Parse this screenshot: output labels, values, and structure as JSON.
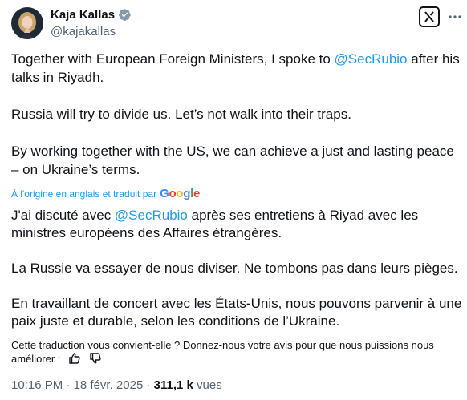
{
  "author": {
    "name": "Kaja Kallas",
    "handle": "@kajakallas"
  },
  "icons": {
    "verified": "verified-badge-icon",
    "grok": "grok-icon",
    "more": "more-options-icon",
    "google": "google-logo",
    "thumbs_up": "thumbs-up-icon",
    "thumbs_down": "thumbs-down-icon"
  },
  "colors": {
    "link": "#1d9bf0",
    "text": "#0f1419",
    "secondary": "#536471",
    "verified": "#829aab"
  },
  "tweet": {
    "para1_before": "Together with European Foreign Ministers, I spoke to ",
    "para1_mention": "@SecRubio",
    "para1_after": " after his talks in Riyadh.",
    "para2": "Russia will try to divide us. Let’s not walk into their traps.",
    "para3": "By working together with the US, we can achieve a just and lasting peace – on Ukraine’s terms."
  },
  "translation": {
    "label": "À l'origine en anglais et traduit par",
    "google": "Google",
    "para1_before": "J'ai discuté avec ",
    "para1_mention": "@SecRubio",
    "para1_after": " après ses entretiens à Riyad avec les ministres européens des Affaires étrangères.",
    "para2": "La Russie va essayer de nous diviser. Ne tombons pas dans leurs pièges.",
    "para3": "En travaillant de concert avec les États-Unis, nous pouvons parvenir à une paix juste et durable, selon les conditions de l’Ukraine.",
    "feedback": "Cette traduction vous convient-elle ? Donnez-nous votre avis pour que nous puissions nous améliorer :"
  },
  "meta": {
    "time": "10:16 PM",
    "separator1": "·",
    "date": "18 févr. 2025",
    "separator2": "·",
    "views_count": "311,1 k",
    "views_label": "vues"
  }
}
